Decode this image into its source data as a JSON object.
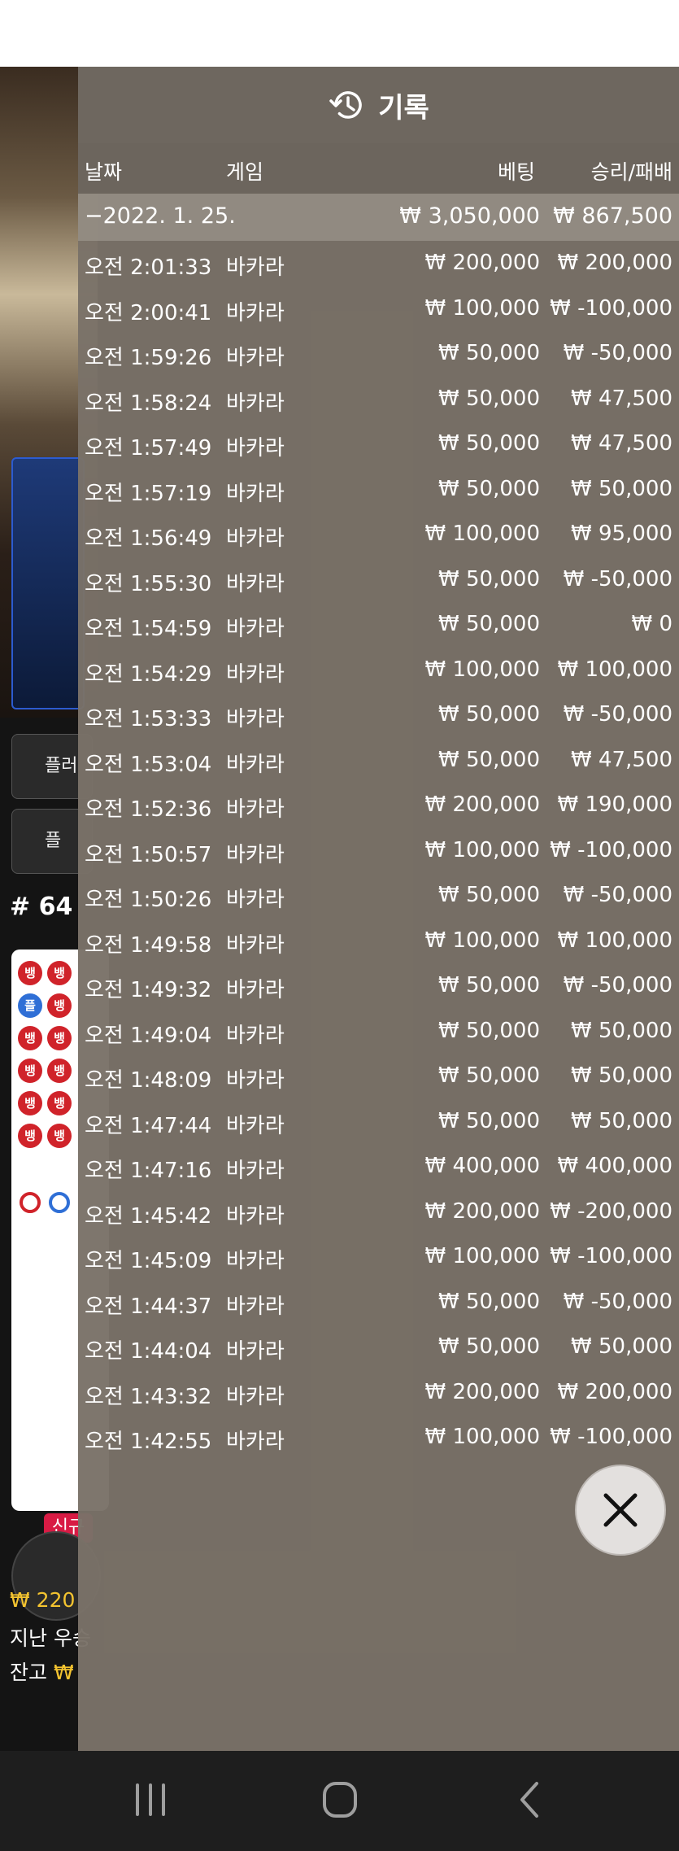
{
  "overlay": {
    "title": "기록",
    "icon": "history-icon",
    "columns": {
      "date": "날짜",
      "game": "게임",
      "bet": "베팅",
      "result": "승리/패배"
    },
    "summary": {
      "date": "−2022. 1. 25.",
      "bet": "₩ 3,050,000",
      "result": "₩ 867,500"
    },
    "rows": [
      {
        "time": "오전 2:01:33",
        "game": "바카라",
        "bet": "₩ 200,000",
        "result": "₩ 200,000"
      },
      {
        "time": "오전 2:00:41",
        "game": "바카라",
        "bet": "₩ 100,000",
        "result": "₩ -100,000"
      },
      {
        "time": "오전 1:59:26",
        "game": "바카라",
        "bet": "₩ 50,000",
        "result": "₩ -50,000"
      },
      {
        "time": "오전 1:58:24",
        "game": "바카라",
        "bet": "₩ 50,000",
        "result": "₩ 47,500"
      },
      {
        "time": "오전 1:57:49",
        "game": "바카라",
        "bet": "₩ 50,000",
        "result": "₩ 47,500"
      },
      {
        "time": "오전 1:57:19",
        "game": "바카라",
        "bet": "₩ 50,000",
        "result": "₩ 50,000"
      },
      {
        "time": "오전 1:56:49",
        "game": "바카라",
        "bet": "₩ 100,000",
        "result": "₩ 95,000"
      },
      {
        "time": "오전 1:55:30",
        "game": "바카라",
        "bet": "₩ 50,000",
        "result": "₩ -50,000"
      },
      {
        "time": "오전 1:54:59",
        "game": "바카라",
        "bet": "₩ 50,000",
        "result": "₩ 0"
      },
      {
        "time": "오전 1:54:29",
        "game": "바카라",
        "bet": "₩ 100,000",
        "result": "₩ 100,000"
      },
      {
        "time": "오전 1:53:33",
        "game": "바카라",
        "bet": "₩ 50,000",
        "result": "₩ -50,000"
      },
      {
        "time": "오전 1:53:04",
        "game": "바카라",
        "bet": "₩ 50,000",
        "result": "₩ 47,500"
      },
      {
        "time": "오전 1:52:36",
        "game": "바카라",
        "bet": "₩ 200,000",
        "result": "₩ 190,000"
      },
      {
        "time": "오전 1:50:57",
        "game": "바카라",
        "bet": "₩ 100,000",
        "result": "₩ -100,000"
      },
      {
        "time": "오전 1:50:26",
        "game": "바카라",
        "bet": "₩ 50,000",
        "result": "₩ -50,000"
      },
      {
        "time": "오전 1:49:58",
        "game": "바카라",
        "bet": "₩ 100,000",
        "result": "₩ 100,000"
      },
      {
        "time": "오전 1:49:32",
        "game": "바카라",
        "bet": "₩ 50,000",
        "result": "₩ -50,000"
      },
      {
        "time": "오전 1:49:04",
        "game": "바카라",
        "bet": "₩ 50,000",
        "result": "₩ 50,000"
      },
      {
        "time": "오전 1:48:09",
        "game": "바카라",
        "bet": "₩ 50,000",
        "result": "₩ 50,000"
      },
      {
        "time": "오전 1:47:44",
        "game": "바카라",
        "bet": "₩ 50,000",
        "result": "₩ 50,000"
      },
      {
        "time": "오전 1:47:16",
        "game": "바카라",
        "bet": "₩ 400,000",
        "result": "₩ 400,000"
      },
      {
        "time": "오전 1:45:42",
        "game": "바카라",
        "bet": "₩ 200,000",
        "result": "₩ -200,000"
      },
      {
        "time": "오전 1:45:09",
        "game": "바카라",
        "bet": "₩ 100,000",
        "result": "₩ -100,000"
      },
      {
        "time": "오전 1:44:37",
        "game": "바카라",
        "bet": "₩ 50,000",
        "result": "₩ -50,000"
      },
      {
        "time": "오전 1:44:04",
        "game": "바카라",
        "bet": "₩ 50,000",
        "result": "₩ 50,000"
      },
      {
        "time": "오전 1:43:32",
        "game": "바카라",
        "bet": "₩ 200,000",
        "result": "₩ 200,000"
      },
      {
        "time": "오전 1:42:55",
        "game": "바카라",
        "bet": "₩ 100,000",
        "result": "₩ -100,000"
      }
    ],
    "close_icon": "close-icon"
  },
  "background": {
    "player_btn_1": "플러",
    "player_btn_2": "플",
    "round": "# 64",
    "road_banker": "뱅",
    "road_player": "플",
    "new_badge": "신규",
    "bet_amount_prefix": "₩ 220",
    "last_win_prefix": "지난 우승",
    "balance_label": "잔고",
    "balance_prefix": "₩"
  },
  "nav": {
    "recent_icon": "recent-apps-icon",
    "home_icon": "home-icon",
    "back_icon": "back-icon"
  },
  "colors": {
    "overlay": "#7a7268",
    "banker": "#d0232a",
    "player": "#2f6fd6",
    "gold": "#f4c430"
  }
}
